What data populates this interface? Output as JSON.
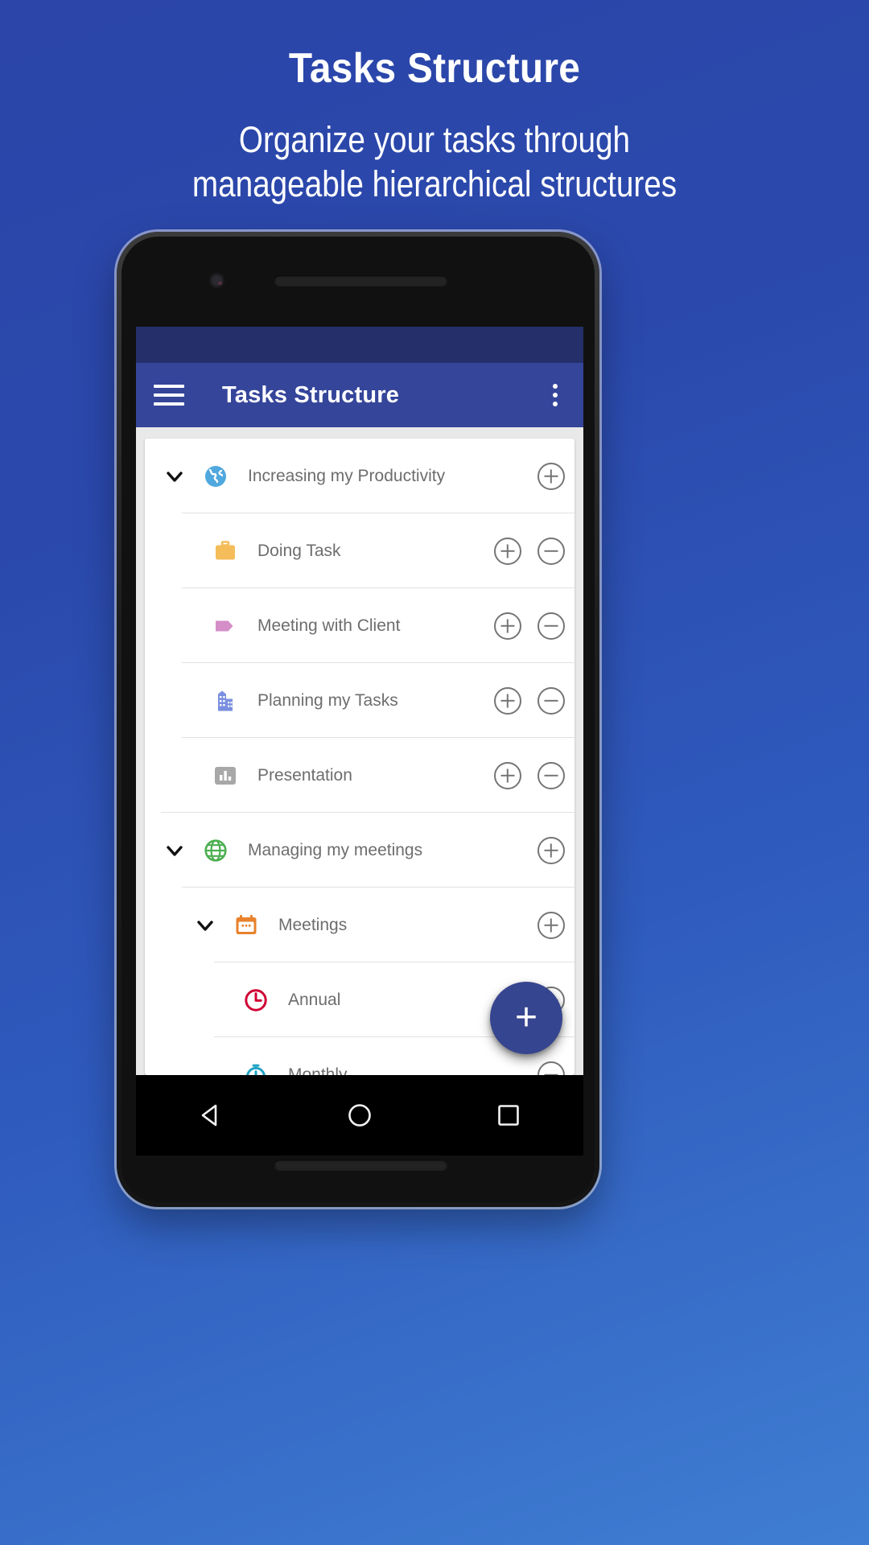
{
  "promo": {
    "title": "Tasks Structure",
    "subtitle_line1": "Organize your tasks through",
    "subtitle_line2": "manageable hierarchical structures"
  },
  "colors": {
    "background_top": "#2b45a8",
    "background_bottom": "#3f7ed2",
    "statusbar": "#25306b",
    "toolbar": "#35459a",
    "fab": "#36458f",
    "card": "#ffffff",
    "label_text": "#6d6d6d",
    "action_outline": "#757575"
  },
  "app": {
    "statusbar": {
      "name": "status-bar"
    },
    "toolbar": {
      "menu_icon": "hamburger-menu-icon",
      "title": "Tasks Structure",
      "overflow_icon": "more-vertical-icon"
    },
    "fab": {
      "label": "+",
      "icon": "plus-icon"
    },
    "navbar": {
      "back": "back-triangle-icon",
      "home": "home-circle-icon",
      "recents": "recents-square-icon"
    },
    "rows": [
      {
        "label": "Increasing my Productivity",
        "icon": "globe-americas-icon",
        "icon_color": "#4fa8de",
        "depth": 0,
        "expandable": true,
        "expanded": true,
        "actions": [
          "add",
          "remove"
        ],
        "show_remove": false
      },
      {
        "label": "Doing Task",
        "icon": "briefcase-icon",
        "icon_color": "#f5bc5a",
        "depth": 1,
        "expandable": false,
        "expanded": false,
        "actions": [
          "add",
          "remove"
        ],
        "show_remove": true
      },
      {
        "label": "Meeting with Client",
        "icon": "tag-label-icon",
        "icon_color": "#d48ec8",
        "depth": 1,
        "expandable": false,
        "expanded": false,
        "actions": [
          "add",
          "remove"
        ],
        "show_remove": true
      },
      {
        "label": "Planning my Tasks",
        "icon": "office-building-icon",
        "icon_color": "#7a8fe0",
        "depth": 1,
        "expandable": false,
        "expanded": false,
        "actions": [
          "add",
          "remove"
        ],
        "show_remove": true
      },
      {
        "label": "Presentation",
        "icon": "bar-chart-icon",
        "icon_color": "#a8a8a8",
        "depth": 1,
        "expandable": false,
        "expanded": false,
        "actions": [
          "add",
          "remove"
        ],
        "show_remove": true
      },
      {
        "label": "Managing my meetings",
        "icon": "globe-grid-icon",
        "icon_color": "#4caf50",
        "depth": 0,
        "expandable": true,
        "expanded": true,
        "actions": [
          "add"
        ],
        "show_remove": false
      },
      {
        "label": "Meetings",
        "icon": "calendar-icon",
        "icon_color": "#e8822c",
        "depth": 2,
        "expandable": true,
        "expanded": true,
        "actions": [
          "add"
        ],
        "show_remove": false
      },
      {
        "label": "Annual",
        "icon": "clock-icon",
        "icon_color": "#d00033",
        "depth": 3,
        "expandable": false,
        "expanded": false,
        "actions": [
          "remove"
        ],
        "show_remove": true
      },
      {
        "label": "Monthly",
        "icon": "stopwatch-icon",
        "icon_color": "#22a3c4",
        "depth": 3,
        "expandable": false,
        "expanded": false,
        "actions": [
          "remove"
        ],
        "show_remove": true
      }
    ]
  }
}
